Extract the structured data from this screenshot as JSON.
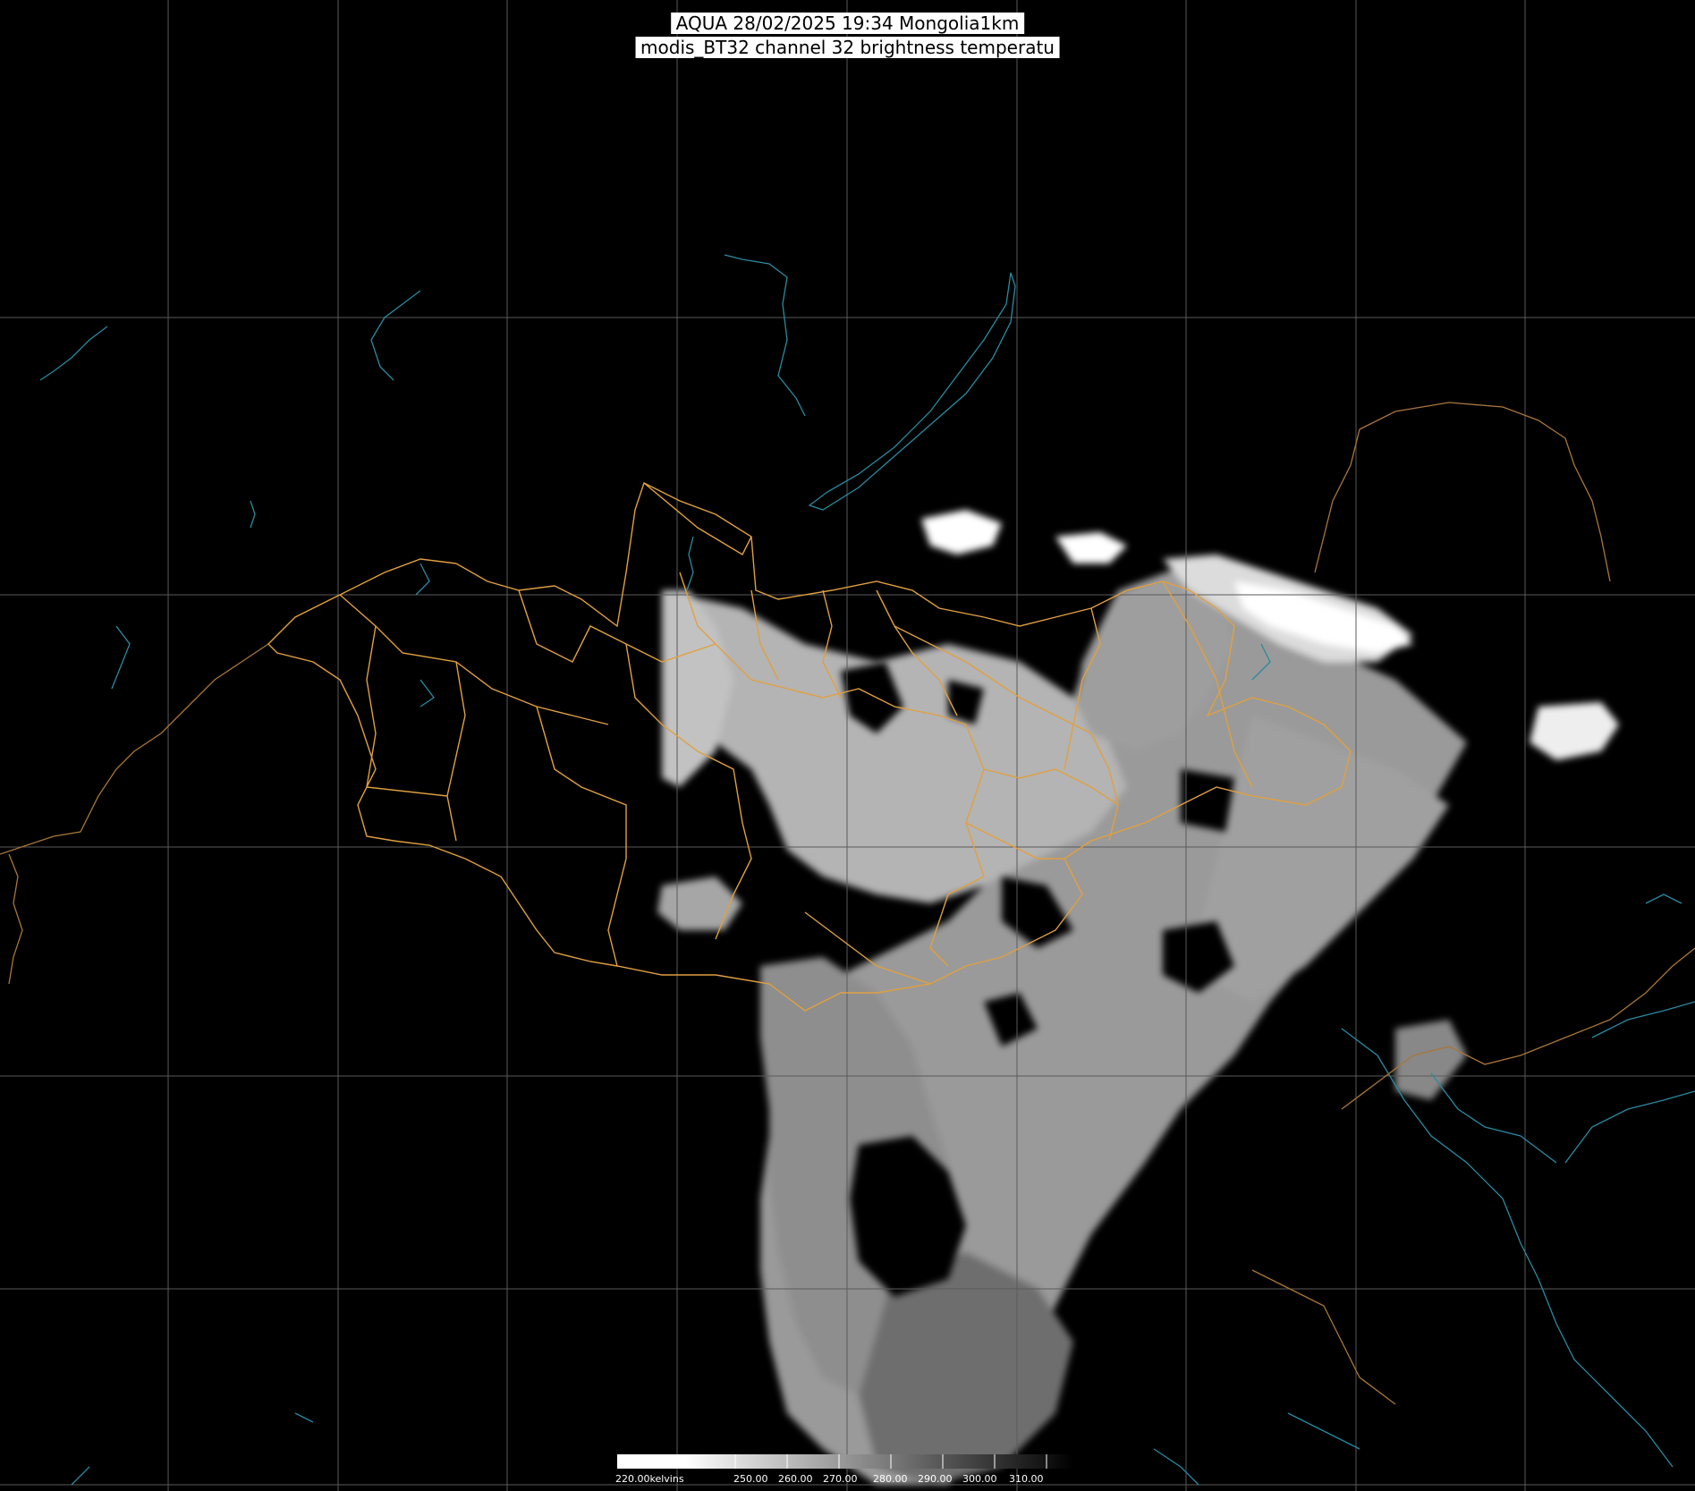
{
  "title": {
    "line1": "AQUA 28/02/2025 19:34 Mongolia1km",
    "line2": "modis_BT32 channel 32 brightness temperatu"
  },
  "colorbar": {
    "units": "kelvins",
    "labels": [
      "220.00kelvins",
      "250.00",
      "260.00",
      "270.00",
      "280.00",
      "290.00",
      "300.00",
      "310.00"
    ]
  },
  "colors": {
    "background": "#000000",
    "graticule": "#5a5a5a",
    "country_border": "#a8763a",
    "province_border": "#e0a040",
    "coastline": "#2a8aa0",
    "cloud_bright": "#ffffff",
    "cloud_mid": "#a8a8a8"
  }
}
